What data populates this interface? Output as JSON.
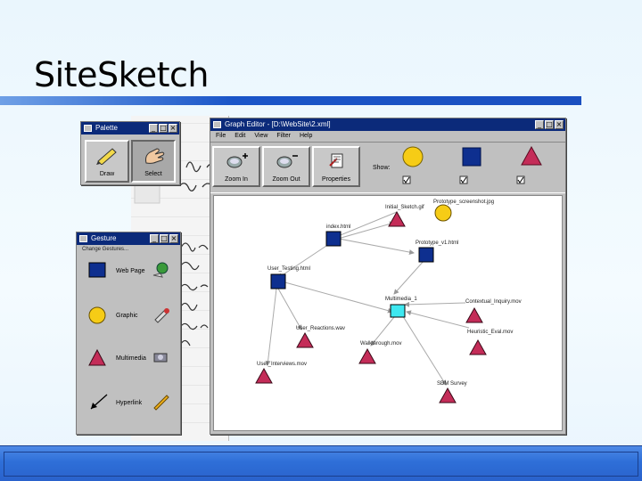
{
  "slide": {
    "title": "SiteSketch"
  },
  "palette_window": {
    "title": "Palette",
    "buttons": [
      {
        "label": "Draw"
      },
      {
        "label": "Select"
      }
    ]
  },
  "gesture_window": {
    "title": "Gesture",
    "subtitle": "Change Gestures...",
    "rows": [
      {
        "label": "Web Page"
      },
      {
        "label": "Graphic"
      },
      {
        "label": "Multimedia"
      },
      {
        "label": "Hyperlink"
      }
    ]
  },
  "graph_window": {
    "title": "Graph Editor - [D:\\WebSite\\2.xml]",
    "menu": [
      "File",
      "Edit",
      "View",
      "Filter",
      "Help"
    ],
    "toolbar": {
      "zoom_in": "Zoom In",
      "zoom_out": "Zoom Out",
      "properties": "Properties",
      "show_label": "Show:"
    },
    "nodes": [
      {
        "id": "n1",
        "label": "Initial_Sketch.gif"
      },
      {
        "id": "n2",
        "label": "Prototype_screenshot.jpg"
      },
      {
        "id": "n3",
        "label": "index.html"
      },
      {
        "id": "n4",
        "label": "Prototype_v1.html"
      },
      {
        "id": "n5",
        "label": "User_Testing.html"
      },
      {
        "id": "n6",
        "label": "Multimedia_1"
      },
      {
        "id": "n7",
        "label": "Contextual_Inquiry.mov"
      },
      {
        "id": "n8",
        "label": "User_Reactions.wav"
      },
      {
        "id": "n9",
        "label": "Heuristic_Eval.mov"
      },
      {
        "id": "n10",
        "label": "Walkthrough.mov"
      },
      {
        "id": "n11",
        "label": "User_Interviews.mov"
      },
      {
        "id": "n12",
        "label": "SDM Survey"
      }
    ]
  },
  "colors": {
    "web_page": "#0e2f8f",
    "graphic": "#f6cc16",
    "multimedia": "#c42c58",
    "selected": "#3ee8f0",
    "title_bar": "#0b2a7a",
    "accent_rule": "#1a55c8"
  }
}
